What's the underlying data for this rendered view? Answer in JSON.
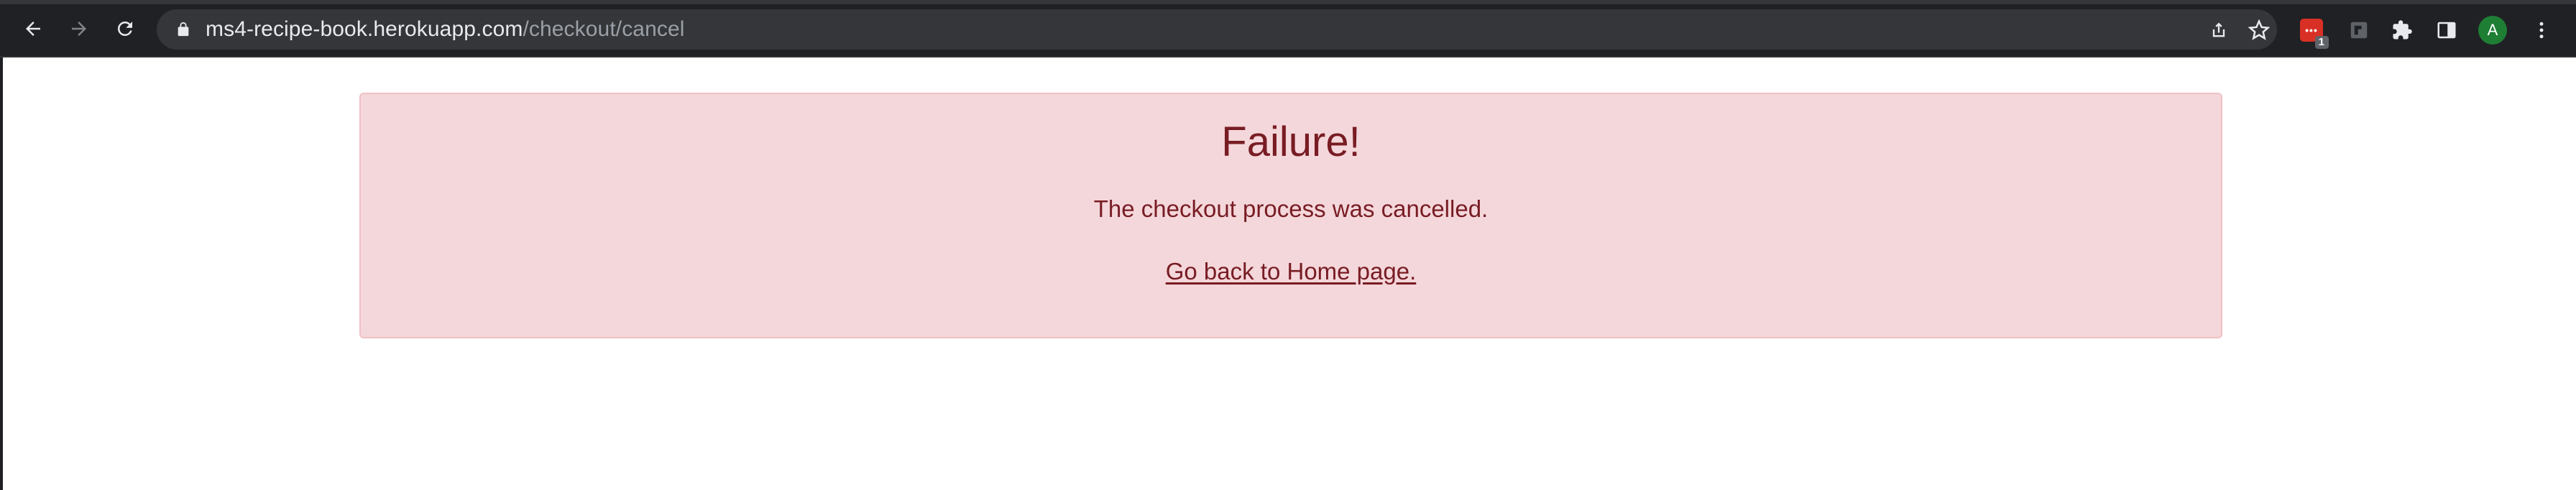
{
  "browser": {
    "url_host": "ms4-recipe-book.herokuapp.com",
    "url_path": "/checkout/cancel",
    "extension_badge_count": "1",
    "profile_initial": "A",
    "icons": {
      "back": "arrow-left-icon",
      "forward": "arrow-right-icon",
      "reload": "reload-icon",
      "lock": "lock-icon",
      "share": "share-icon",
      "bookmark": "star-icon",
      "extension_1": "password-extension-icon",
      "extension_2": "pin-extension-icon",
      "extensions": "puzzle-icon",
      "sidepanel": "side-panel-icon",
      "menu": "kebab-menu-icon"
    }
  },
  "alert": {
    "title": "Failure!",
    "message": "The checkout process was cancelled.",
    "link_text": "Go back to Home page.",
    "colors": {
      "background": "#f4d7da",
      "border": "#f0c1c6",
      "text": "#781c24"
    }
  }
}
